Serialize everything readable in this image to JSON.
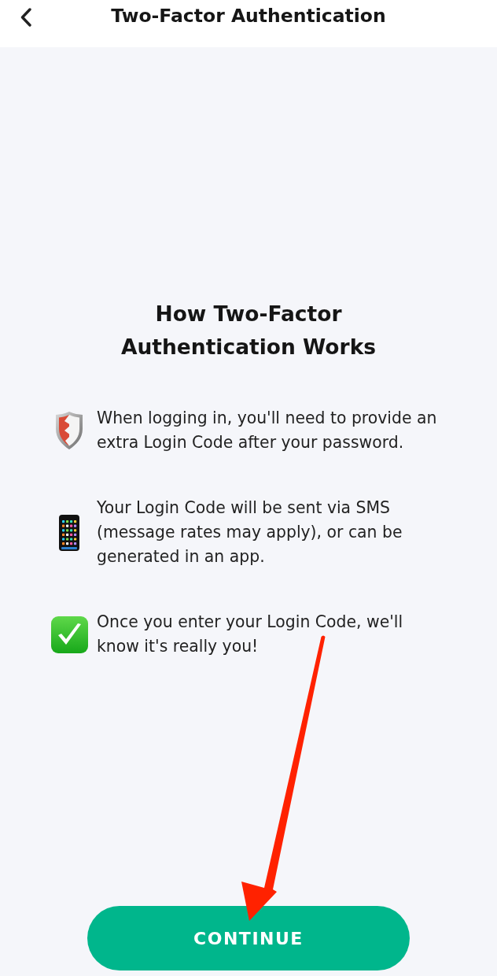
{
  "header": {
    "title": "Two-Factor Authentication"
  },
  "heading": "How Two-Factor Authentication Works",
  "items": [
    {
      "kind": "shield",
      "text": "When logging in, you'll need to provide an extra Login Code after your password."
    },
    {
      "kind": "phone",
      "text": "Your Login Code will be sent via SMS (message rates may apply), or can be generated in an app."
    },
    {
      "kind": "check",
      "text": "Once you enter your Login Code, we'll know it's really you!"
    }
  ],
  "button": {
    "label": "CONTINUE"
  },
  "annotations": [
    {
      "kind": "arrow"
    }
  ]
}
